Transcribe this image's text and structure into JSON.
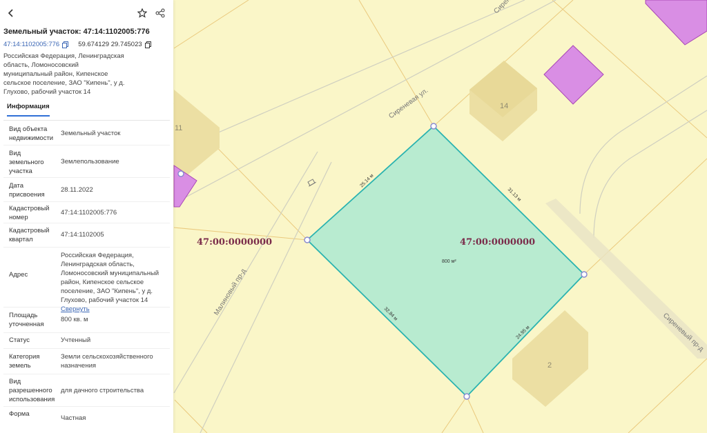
{
  "panel": {
    "title": "Земельный участок: 47:14:1102005:776",
    "cadastral_link": "47:14:1102005:776",
    "coords": "59.674129 29.745023",
    "address_short": "Российская Федерация, Ленинградская область, Ломоносовский муниципальный район, Кипенское сельское поселение, ЗАО \"Кипень\", у д. Глухово, рабочий участок 14",
    "tab_info": "Информация",
    "rows": [
      {
        "label": "Вид объекта недвижимости",
        "value": "Земельный участок"
      },
      {
        "label": "Вид земельного участка",
        "value": "Землепользование"
      },
      {
        "label": "Дата присвоения",
        "value": "28.11.2022"
      },
      {
        "label": "Кадастровый номер",
        "value": "47:14:1102005:776"
      },
      {
        "label": "Кадастровый квартал",
        "value": "47:14:1102005"
      },
      {
        "label": "Адрес",
        "value": "Российская Федерация, Ленинградская область, Ломоносовский муниципальный район, Кипенское сельское поселение, ЗАО \"Кипень\", у д. Глухово, рабочий участок 14",
        "link": "Свернуть"
      },
      {
        "label": "Площадь уточненная",
        "value": "800 кв. м"
      },
      {
        "label": "Статус",
        "value": "Учтенный"
      },
      {
        "label": "Категория земель",
        "value": "Земли сельскохозяйственного назначения"
      },
      {
        "label": "Вид разрешенного использования",
        "value": "для дачного строительства"
      },
      {
        "label": "Форма",
        "value": "Частная"
      }
    ]
  },
  "map": {
    "streets": {
      "sirenevaya_top": "Сиреневая ул.",
      "sirenevaya_mid": "Сиреневая ул.",
      "malinovy": "Малиновый пр-д",
      "sireneviy": "Сиреневый пр-д"
    },
    "quarter_left": "47:00:0000000",
    "quarter_right": "47:00:0000000",
    "area": "800 м²",
    "edges": {
      "top_left": "25.14 м",
      "top_right": "31.13 м",
      "bottom_left": "32.84 м",
      "bottom_right": "24.95 м"
    },
    "buildings": {
      "b14": "14",
      "b11": "11",
      "b2": "2"
    },
    "colors": {
      "background": "#faf6c8",
      "parcel_fill": "#b8ebd0",
      "parcel_stroke": "#2ab3b0",
      "building": "#ecdfa3",
      "magenta": "#d98ee4",
      "quarter_label": "#7a2b4a"
    }
  }
}
